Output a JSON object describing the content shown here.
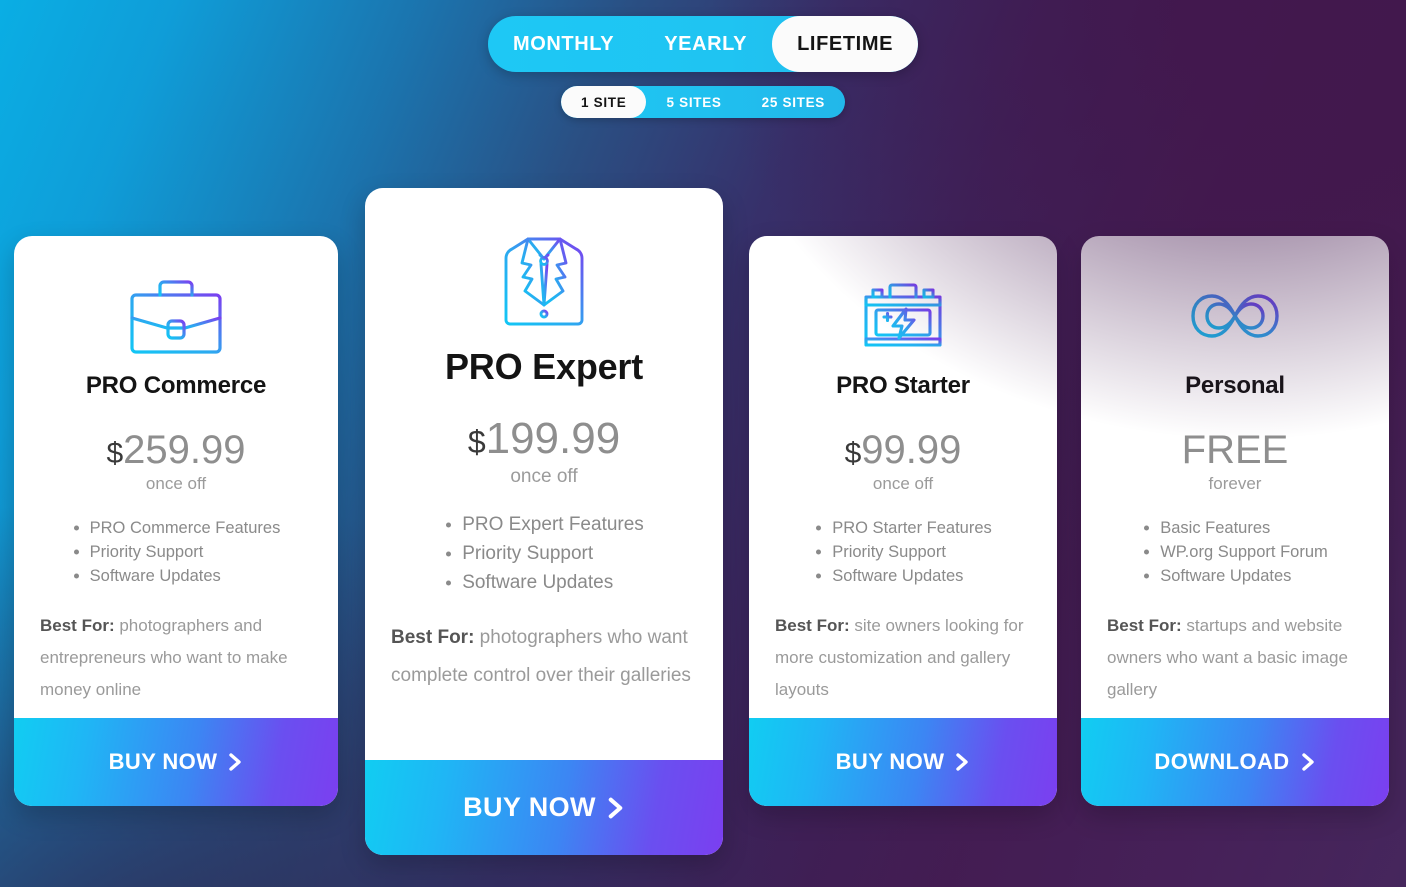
{
  "theme": {
    "bg_cyan": "#0aaee4",
    "bg_purple": "#421a4e",
    "bg_navy": "#2e2b54",
    "accent_cyan": "#1ec8f5",
    "accent_purple": "#7b3ff0",
    "icon_gradient_start": "#12c6f5",
    "icon_gradient_end": "#7b3ff0"
  },
  "period_switch": {
    "options": [
      {
        "label": "MONTHLY",
        "active": false
      },
      {
        "label": "YEARLY",
        "active": false
      },
      {
        "label": "LIFETIME",
        "active": true
      }
    ]
  },
  "site_switch": {
    "options": [
      {
        "label": "1 SITE",
        "active": true
      },
      {
        "label": "5 SITES",
        "active": false
      },
      {
        "label": "25 SITES",
        "active": false
      }
    ]
  },
  "plans": [
    {
      "id": "commerce",
      "icon": "briefcase-icon",
      "name": "PRO Commerce",
      "currency": "$",
      "price": "259.99",
      "price_note": "once off",
      "features": [
        "PRO Commerce Features",
        "Priority Support",
        "Software Updates"
      ],
      "bestfor_label": "Best For:",
      "bestfor_text": " photographers and entrepreneurs who want to make money online",
      "cta_label": "BUY NOW",
      "featured": false
    },
    {
      "id": "expert",
      "icon": "suit-jacket-icon",
      "name": "PRO Expert",
      "currency": "$",
      "price": "199.99",
      "price_note": "once off",
      "features": [
        "PRO Expert Features",
        "Priority Support",
        "Software Updates"
      ],
      "bestfor_label": "Best For:",
      "bestfor_text": " photographers who want complete control over their galleries",
      "cta_label": "BUY NOW",
      "featured": true
    },
    {
      "id": "starter",
      "icon": "car-battery-icon",
      "name": "PRO Starter",
      "currency": "$",
      "price": "99.99",
      "price_note": "once off",
      "features": [
        "PRO Starter Features",
        "Priority Support",
        "Software Updates"
      ],
      "bestfor_label": "Best For:",
      "bestfor_text": " site owners looking for more customization and gallery layouts",
      "cta_label": "BUY NOW",
      "featured": false
    },
    {
      "id": "personal",
      "icon": "infinity-icon",
      "name": "Personal",
      "currency": "",
      "price": "FREE",
      "price_note": "forever",
      "features": [
        "Basic Features",
        "WP.org Support Forum",
        "Software Updates"
      ],
      "bestfor_label": "Best For:",
      "bestfor_text": " startups and website owners who want a basic image gallery",
      "cta_label": "DOWNLOAD",
      "featured": false
    }
  ]
}
